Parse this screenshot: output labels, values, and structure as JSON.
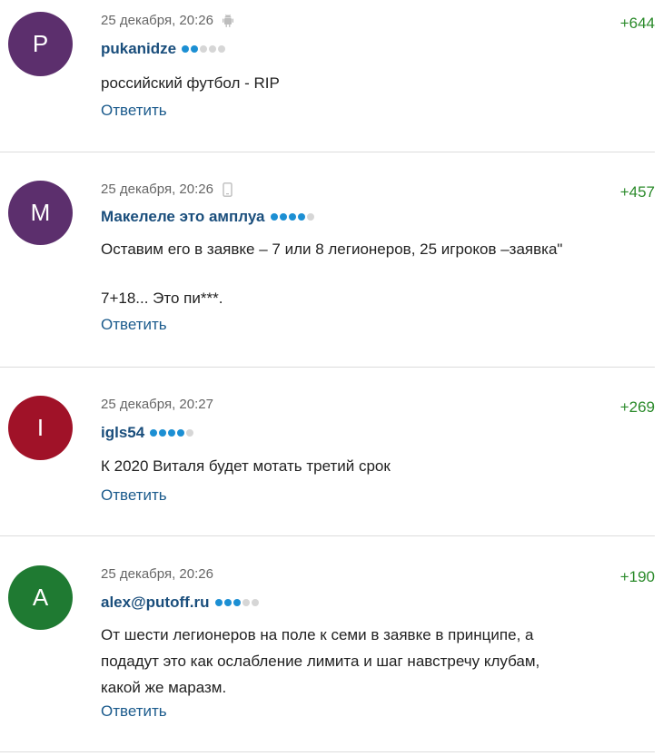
{
  "comments": [
    {
      "avatar_letter": "P",
      "avatar_color": "#5c2f6d",
      "date": "25 декабря, 20:26",
      "device_icon": "android-icon",
      "author": "pukanidze",
      "rating_dots_filled": 2,
      "rating_dots_total": 5,
      "score": "+644",
      "text": [
        "российский футбол - RIP"
      ],
      "reply_label": "Ответить"
    },
    {
      "avatar_letter": "M",
      "avatar_color": "#5c2f6d",
      "date": "25 декабря, 20:26",
      "device_icon": "mobile-phone-icon",
      "author": "Макелеле это амплуа",
      "rating_dots_filled": 4,
      "rating_dots_total": 5,
      "score": "+457",
      "text": [
        "Оставим его в заявке – 7 или 8 легионеров, 25 игроков –заявка\"",
        "",
        "7+18... Это пи***."
      ],
      "reply_label": "Ответить"
    },
    {
      "avatar_letter": "I",
      "avatar_color": "#a01228",
      "date": "25 декабря, 20:27",
      "device_icon": "",
      "author": "igls54",
      "rating_dots_filled": 4,
      "rating_dots_total": 5,
      "score": "+269",
      "text": [
        "К 2020 Виталя будет мотать третий срок"
      ],
      "reply_label": "Ответить"
    },
    {
      "avatar_letter": "A",
      "avatar_color": "#1f7a32",
      "date": "25 декабря, 20:26",
      "device_icon": "",
      "author": "alex@putoff.ru",
      "rating_dots_filled": 3,
      "rating_dots_total": 5,
      "score": "+190",
      "text": [
        "От шести легионеров на поле к семи в заявке в принципе, а",
        "подадут это как ослабление лимита и шаг навстречу клубам,",
        "какой же маразм."
      ],
      "reply_label": "Ответить"
    }
  ]
}
